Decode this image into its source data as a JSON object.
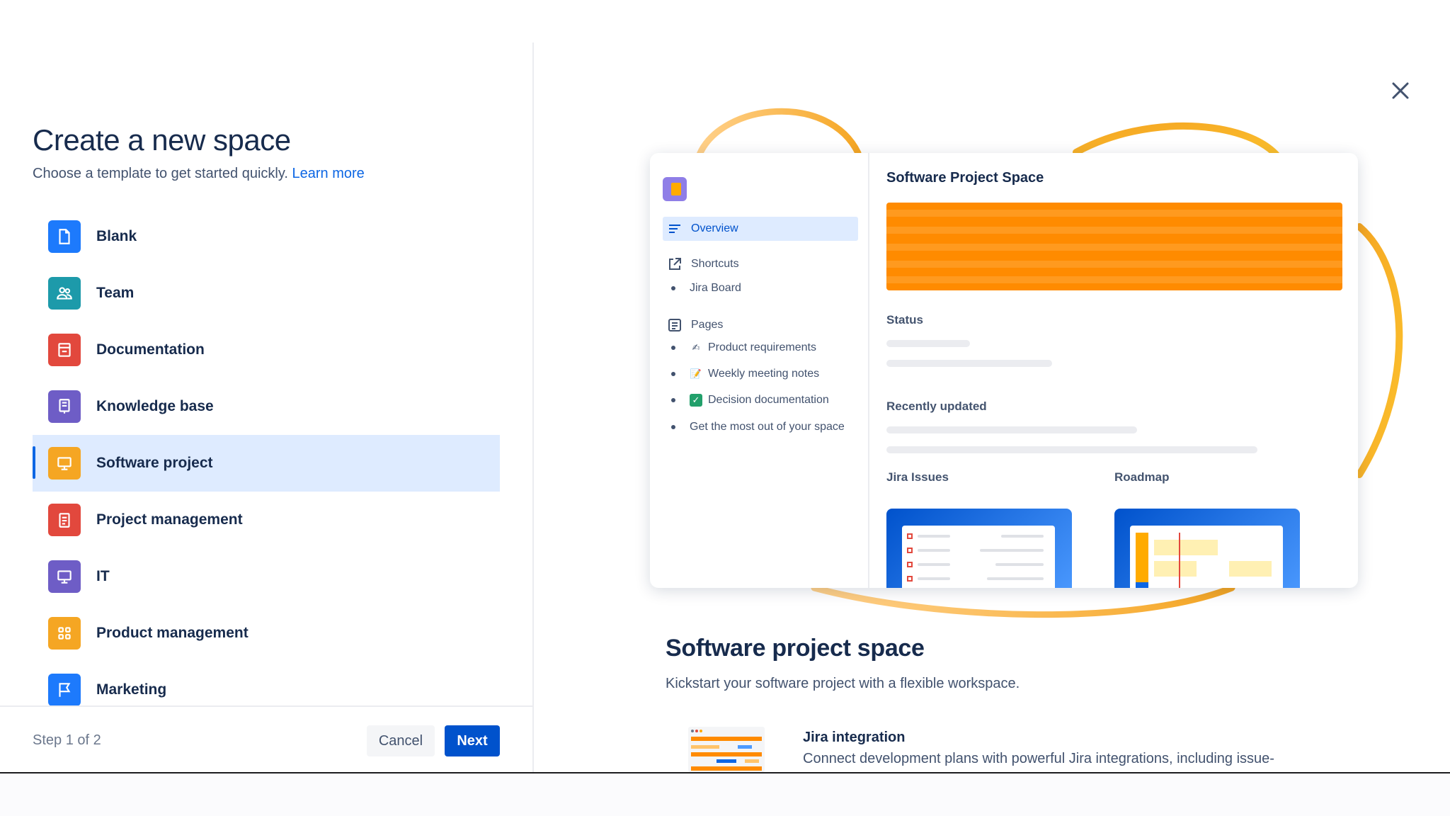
{
  "dialog": {
    "title": "Create a new space",
    "subtitle": "Choose a template to get started quickly.",
    "learn_more": "Learn more"
  },
  "templates": [
    {
      "label": "Blank",
      "icon": "page-icon",
      "color": "#1d7afc"
    },
    {
      "label": "Team",
      "icon": "people-icon",
      "color": "#1d9aaa"
    },
    {
      "label": "Documentation",
      "icon": "archive-icon",
      "color": "#e2483d"
    },
    {
      "label": "Knowledge base",
      "icon": "book-icon",
      "color": "#6e5dc6"
    },
    {
      "label": "Software project",
      "icon": "monitor-icon",
      "color": "#f5a623",
      "selected": true
    },
    {
      "label": "Project management",
      "icon": "clipboard-icon",
      "color": "#e2483d"
    },
    {
      "label": "IT",
      "icon": "desktop-icon",
      "color": "#6e5dc6"
    },
    {
      "label": "Product management",
      "icon": "grid-icon",
      "color": "#f5a623"
    },
    {
      "label": "Marketing",
      "icon": "flag-icon",
      "color": "#1d7afc"
    }
  ],
  "footer": {
    "step": "Step 1 of 2",
    "cancel": "Cancel",
    "next": "Next"
  },
  "preview": {
    "space_title": "Software Project Space",
    "nav": {
      "overview": "Overview",
      "shortcuts": "Shortcuts",
      "jira_board": "Jira Board",
      "pages": "Pages",
      "page_items": [
        "Product requirements",
        "Weekly meeting notes",
        "Decision documentation",
        "Get the most out of your space"
      ]
    },
    "status": "Status",
    "recently_updated": "Recently updated",
    "jira_issues": "Jira Issues",
    "roadmap": "Roadmap"
  },
  "description": {
    "title": "Software project space",
    "subtitle": "Kickstart your software project with a flexible workspace.",
    "feature_title": "Jira integration",
    "feature_desc": "Connect development plans with powerful Jira integrations, including issue-"
  },
  "colors": {
    "accent": "#0052cc",
    "selected_bg": "#deebff",
    "banner": "#ff8b00"
  }
}
